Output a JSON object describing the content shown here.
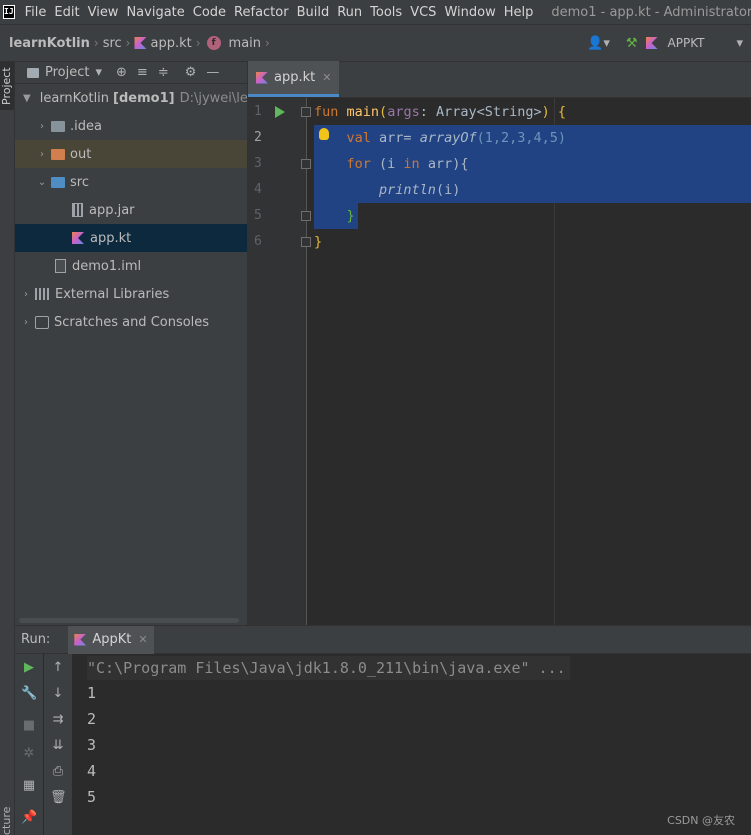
{
  "menu": {
    "items": [
      "File",
      "Edit",
      "View",
      "Navigate",
      "Code",
      "Refactor",
      "Build",
      "Run",
      "Tools",
      "VCS",
      "Window",
      "Help"
    ],
    "window_title": "demo1 - app.kt - Administrator"
  },
  "nav": {
    "project": "learnKotlin",
    "folder": "src",
    "file": "app.kt",
    "function": "main",
    "run_config": "APPKT"
  },
  "stripe": {
    "project_tab": "Project",
    "structure_tab": "cture"
  },
  "project_panel": {
    "title": "Project",
    "root_label": "learnKotlin",
    "root_module": "[demo1]",
    "root_path": "D:\\jywei\\lear",
    "items": [
      {
        "label": ".idea"
      },
      {
        "label": "out"
      },
      {
        "label": "src"
      },
      {
        "label": "app.jar"
      },
      {
        "label": "app.kt"
      },
      {
        "label": "demo1.iml"
      },
      {
        "label": "External Libraries"
      },
      {
        "label": "Scratches and Consoles"
      }
    ]
  },
  "editor": {
    "tab": "app.kt",
    "line_numbers": [
      "1",
      "2",
      "3",
      "4",
      "5",
      "6"
    ],
    "code": {
      "l1_kw": "fun",
      "l1_fn": "main",
      "l1_open": "(",
      "l1_param": "args",
      "l1_colon": ": Array<String>",
      "l1_close": ")",
      "l1_brace": " {",
      "l2_kw": "val",
      "l2_rest": " arr= ",
      "l2_fn": "arrayOf",
      "l2_args": "(1,2,3,4,5)",
      "l3_kw": "for",
      "l3_open": " (i ",
      "l3_in": "in",
      "l3_rest": " arr){",
      "l4_fn": "println",
      "l4_args": "(i)",
      "l5": "}",
      "l6": "}"
    }
  },
  "run_panel": {
    "label": "Run:",
    "tab": "AppKt",
    "command": "\"C:\\Program Files\\Java\\jdk1.8.0_211\\bin\\java.exe\" ...",
    "output": [
      "1",
      "2",
      "3",
      "4",
      "5"
    ]
  },
  "watermark": "CSDN @友农",
  "colors": {
    "selection": "#214283",
    "keyword": "#cc7832",
    "function": "#ffc66d",
    "number": "#6897bb",
    "run_green": "#5fb85c"
  }
}
